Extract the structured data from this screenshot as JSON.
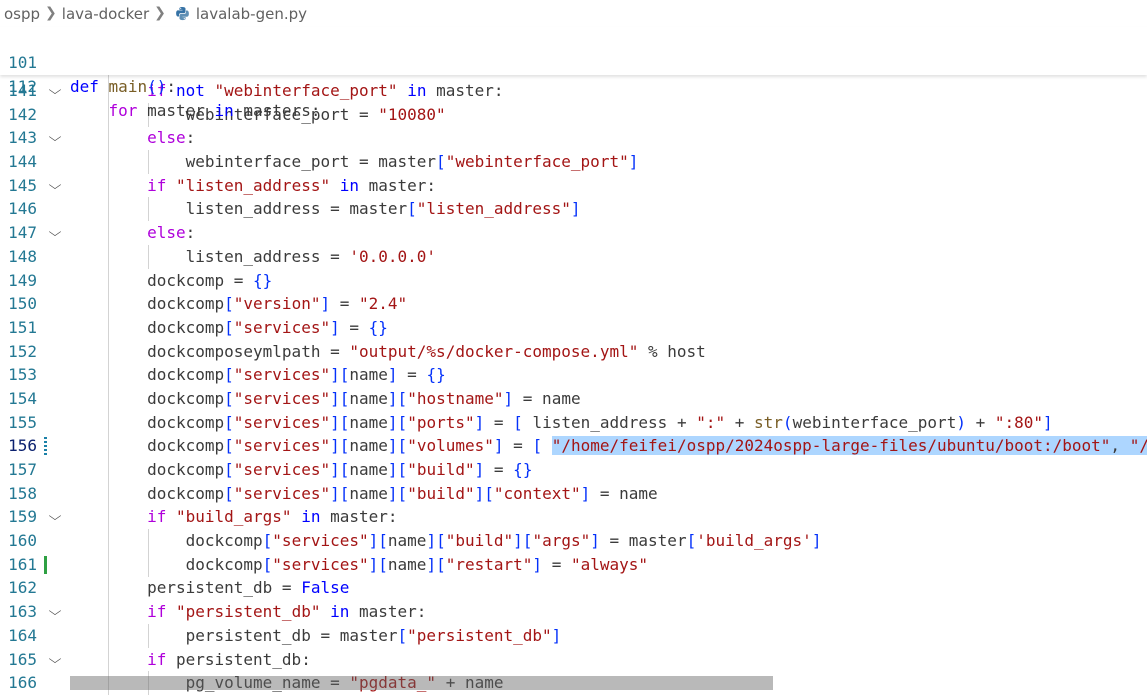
{
  "breadcrumb": {
    "folder1": "ospp",
    "folder2": "lava-docker",
    "file": "lavalab-gen.py",
    "file_icon": "python-icon"
  },
  "sticky_lines": [
    {
      "num": "101",
      "text": "def main():"
    },
    {
      "num": "112",
      "text": "    for master in masters:"
    }
  ],
  "code_lines": [
    {
      "num": "141",
      "text": "        if not \"webinterface_port\" in master:",
      "fold": true
    },
    {
      "num": "142",
      "text": "            webinterface_port = \"10080\""
    },
    {
      "num": "143",
      "text": "        else:",
      "fold": true
    },
    {
      "num": "144",
      "text": "            webinterface_port = master[\"webinterface_port\"]"
    },
    {
      "num": "145",
      "text": "        if \"listen_address\" in master:",
      "fold": true
    },
    {
      "num": "146",
      "text": "            listen_address = master[\"listen_address\"]"
    },
    {
      "num": "147",
      "text": "        else:",
      "fold": true
    },
    {
      "num": "148",
      "text": "            listen_address = '0.0.0.0'"
    },
    {
      "num": "149",
      "text": "        dockcomp = {}"
    },
    {
      "num": "150",
      "text": "        dockcomp[\"version\"] = \"2.4\""
    },
    {
      "num": "151",
      "text": "        dockcomp[\"services\"] = {}"
    },
    {
      "num": "152",
      "text": "        dockcomposeymlpath = \"output/%s/docker-compose.yml\" % host"
    },
    {
      "num": "153",
      "text": "        dockcomp[\"services\"][name] = {}"
    },
    {
      "num": "154",
      "text": "        dockcomp[\"services\"][name][\"hostname\"] = name"
    },
    {
      "num": "155",
      "text": "        dockcomp[\"services\"][name][\"ports\"] = [ listen_address + \":\" + str(webinterface_port) + \":80\"]"
    },
    {
      "num": "156",
      "text": "        dockcomp[\"services\"][name][\"volumes\"] = [ \"/home/feifei/ospp/2024ospp-large-files/ubuntu/boot:/boot\", \"/",
      "active": true,
      "mark": "modified"
    },
    {
      "num": "157",
      "text": "        dockcomp[\"services\"][name][\"build\"] = {}"
    },
    {
      "num": "158",
      "text": "        dockcomp[\"services\"][name][\"build\"][\"context\"] = name"
    },
    {
      "num": "159",
      "text": "        if \"build_args\" in master:",
      "fold": true
    },
    {
      "num": "160",
      "text": "            dockcomp[\"services\"][name][\"build\"][\"args\"] = master['build_args']"
    },
    {
      "num": "161",
      "text": "            dockcomp[\"services\"][name][\"restart\"] = \"always\"",
      "mark": "added"
    },
    {
      "num": "162",
      "text": "        persistent_db = False"
    },
    {
      "num": "163",
      "text": "        if \"persistent_db\" in master:",
      "fold": true
    },
    {
      "num": "164",
      "text": "            persistent_db = master[\"persistent_db\"]"
    },
    {
      "num": "165",
      "text": "        if persistent_db:",
      "fold": true
    },
    {
      "num": "166",
      "text": "            pg_volume_name = \"pgdata_\" + name"
    }
  ],
  "selection": "\"/home/feifei/ospp/2024ospp-large-files/ubuntu/boot:/boot\", \"/",
  "colors": {
    "keyword": "#0000ff",
    "control_keyword": "#af00db",
    "function": "#795e26",
    "string": "#a31515",
    "bracket": "#0431fa",
    "line_number": "#237893",
    "selection": "#add6ff",
    "added_mark": "#2ea043",
    "modified_mark": "#1b81a8"
  }
}
